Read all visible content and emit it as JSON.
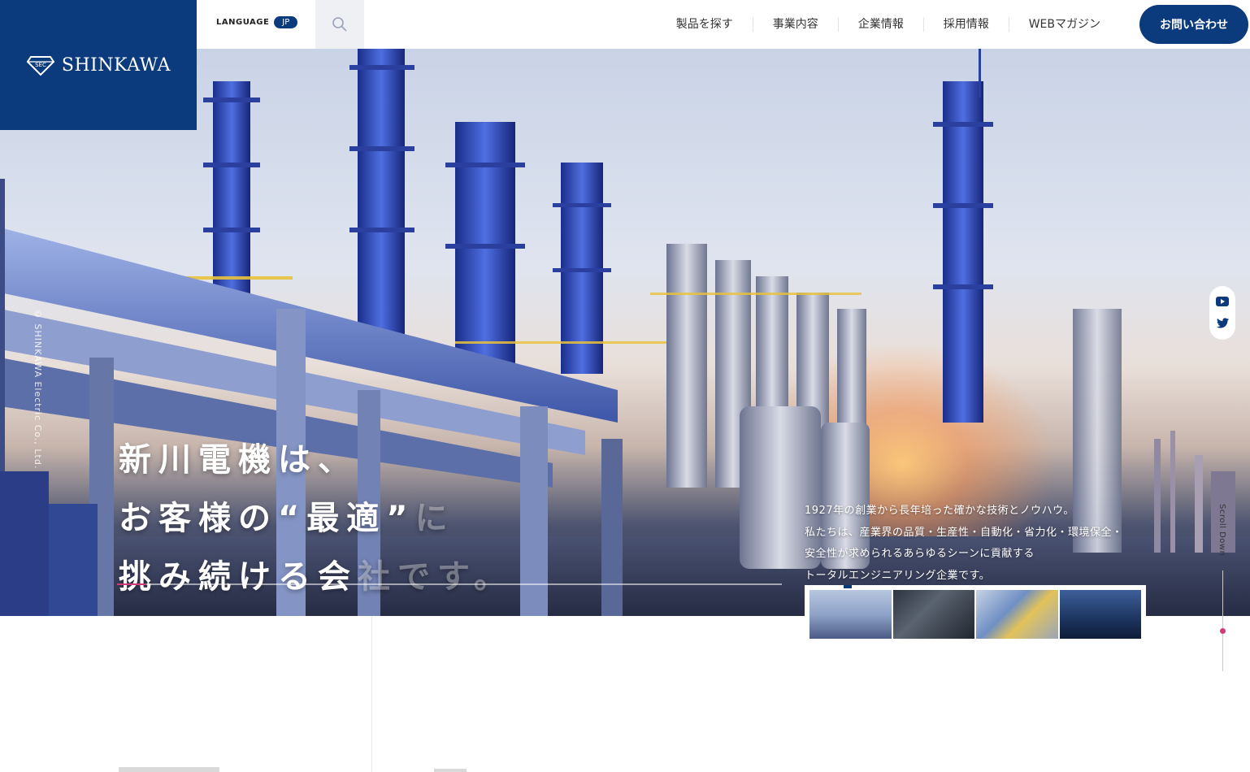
{
  "brand": {
    "name": "SHINKAWA",
    "emblem": "SEC"
  },
  "header": {
    "language_label": "LANGUAGE",
    "language_value": "JP",
    "nav": [
      "製品を探す",
      "事業内容",
      "企業情報",
      "採用情報",
      "WEBマガジン"
    ],
    "contact_label": "お問い合わせ"
  },
  "hero": {
    "vertical_copyright": "© SHINKAWA Electric Co., Ltd.",
    "headline": {
      "line1": "新川電機は、",
      "line2_main": "お客様の“最適”",
      "line2_fade": "に",
      "line3_main": "挑み続ける会",
      "line3_fade": "社です。"
    },
    "description": [
      "1927年の創業から長年培った確かな技術とノウハウ。",
      "私たちは、産業界の品質・生産性・自動化・省力化・環境保全・",
      "安全性が求められるあらゆるシーンに貢献する",
      "トータルエンジニアリング企業です。"
    ],
    "slide_progress": 0.044,
    "scroll_label": "Scroll Down"
  },
  "social": {
    "icons": [
      "youtube-icon",
      "twitter-icon"
    ]
  },
  "colors": {
    "brand": "#0b3a7d",
    "accent": "#d33a7a"
  }
}
